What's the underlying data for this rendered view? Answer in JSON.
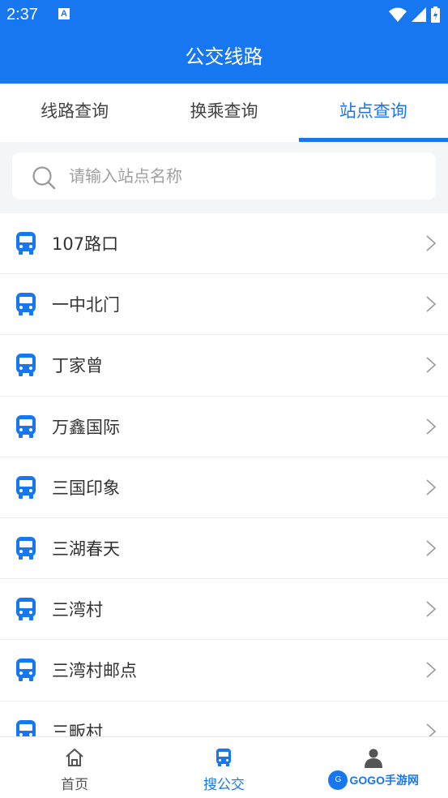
{
  "status_bar": {
    "time": "2:37",
    "notification_glyph": "A"
  },
  "header": {
    "title": "公交线路"
  },
  "tabs": [
    {
      "label": "线路查询",
      "active": false
    },
    {
      "label": "换乘查询",
      "active": false
    },
    {
      "label": "站点查询",
      "active": true
    }
  ],
  "search": {
    "placeholder": "请输入站点名称",
    "value": ""
  },
  "stations": [
    {
      "name": "107路口"
    },
    {
      "name": "一中北门"
    },
    {
      "name": "丁家曾"
    },
    {
      "name": "万鑫国际"
    },
    {
      "name": "三国印象"
    },
    {
      "name": "三湖春天"
    },
    {
      "name": "三湾村"
    },
    {
      "name": "三湾村邮点"
    },
    {
      "name": "三畈村"
    }
  ],
  "bottom_nav": [
    {
      "label": "首页",
      "icon": "home-icon",
      "active": false
    },
    {
      "label": "搜公交",
      "icon": "bus-icon",
      "active": true
    },
    {
      "label": "",
      "icon": "user-icon",
      "active": false
    }
  ],
  "watermark": {
    "text": "GOGO手游网"
  },
  "colors": {
    "primary": "#1677f1",
    "text": "#333333",
    "muted": "#a0a0a0",
    "background": "#f4f5f7"
  }
}
